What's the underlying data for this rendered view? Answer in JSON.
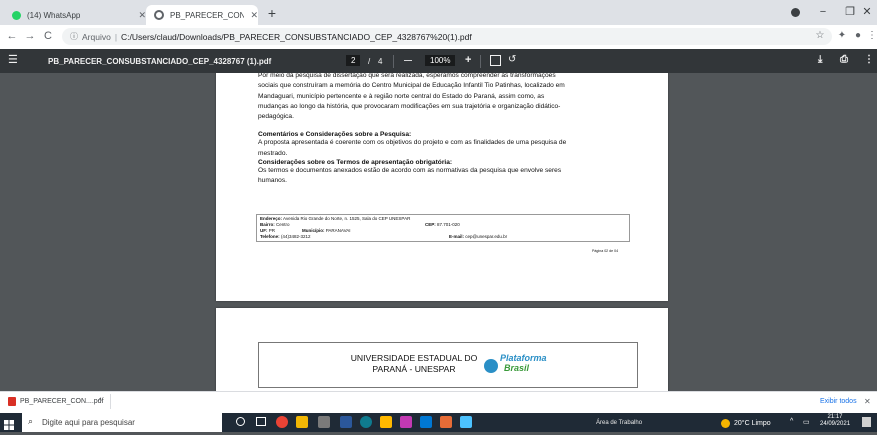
{
  "tabs": [
    {
      "title": "(14) WhatsApp",
      "active": false,
      "favicon_color": "#25d366"
    },
    {
      "title": "PB_PARECER_CONSUBSTANCIAD",
      "active": true,
      "favicon_color": "#5f6368"
    }
  ],
  "new_tab_label": "+",
  "window_controls": {
    "minimize": "−",
    "restore": "❐",
    "close": "✕"
  },
  "address": {
    "protocol_label": "Arquivo",
    "separator": "|",
    "url": "C:/Users/claud/Downloads/PB_PARECER_CONSUBSTANCIADO_CEP_4328767%20(1).pdf"
  },
  "pdf_toolbar": {
    "filename": "PB_PARECER_CONSUBSTANCIADO_CEP_4328767 (1).pdf",
    "current_page": "2",
    "page_sep": "/",
    "total_pages": "4",
    "zoom_minus": "—",
    "zoom": "100%",
    "zoom_plus": "+"
  },
  "document": {
    "intro_lines": [
      "Por meio da pesquisa de dissertação que será realizada, esperamos compreender as transformações",
      "sociais que construíram a memória do Centro Municipal de Educação Infantil Tio Patinhas, localizado em",
      "Mandaguari, município pertencente e à região norte central do Estado do Paraná, assim como, as",
      "mudanças ao longo da história, que provocaram modificações em sua trajetória e organização didático-",
      "pedagógica."
    ],
    "heading1": "Comentários e Considerações sobre a Pesquisa:",
    "para1_lines": [
      "A proposta apresentada é coerente com os objetivos do projeto e com as finalidades de uma pesquisa de",
      "mestrado."
    ],
    "heading2": "Considerações sobre os Termos de apresentação obrigatória:",
    "para2_lines": [
      "Os termos e documentos anexados estão de acordo com as normativas da pesquisa que envolve seres",
      "humanos."
    ],
    "address_box": {
      "endereco_label": "Endereço:",
      "endereco": "Avenida Rio Grande do Norte, n. 1525, Sala do CEP UNESPAR",
      "bairro_label": "Bairro:",
      "bairro": "Centro",
      "cep_label": "CEP:",
      "cep": "87.701-020",
      "uf_label": "UF:",
      "uf": "PR",
      "municipio_label": "Município:",
      "municipio": "PARANAVAI",
      "telefone_label": "Telefone:",
      "telefone": "(44)3482-3212",
      "email_label": "E-mail:",
      "email": "cep@unespar.edu.br"
    },
    "page_footer": "Página 02 de 04",
    "next_page_header_line1": "UNIVERSIDADE ESTADUAL DO",
    "next_page_header_line2": "PARANÁ - UNESPAR",
    "logo_text_top": "Plataforma",
    "logo_text_bottom": "Brasil"
  },
  "download_bar": {
    "item_name": "PB_PARECER_CON....pdf",
    "caret": "^",
    "show_all": "Exibir todos",
    "close": "✕"
  },
  "taskbar": {
    "search_placeholder": "Digite aqui para pesquisar",
    "desktop_label": "Área de Trabalho",
    "weather": "20°C  Limpo",
    "time": "21:17",
    "date": "24/09/2021"
  }
}
